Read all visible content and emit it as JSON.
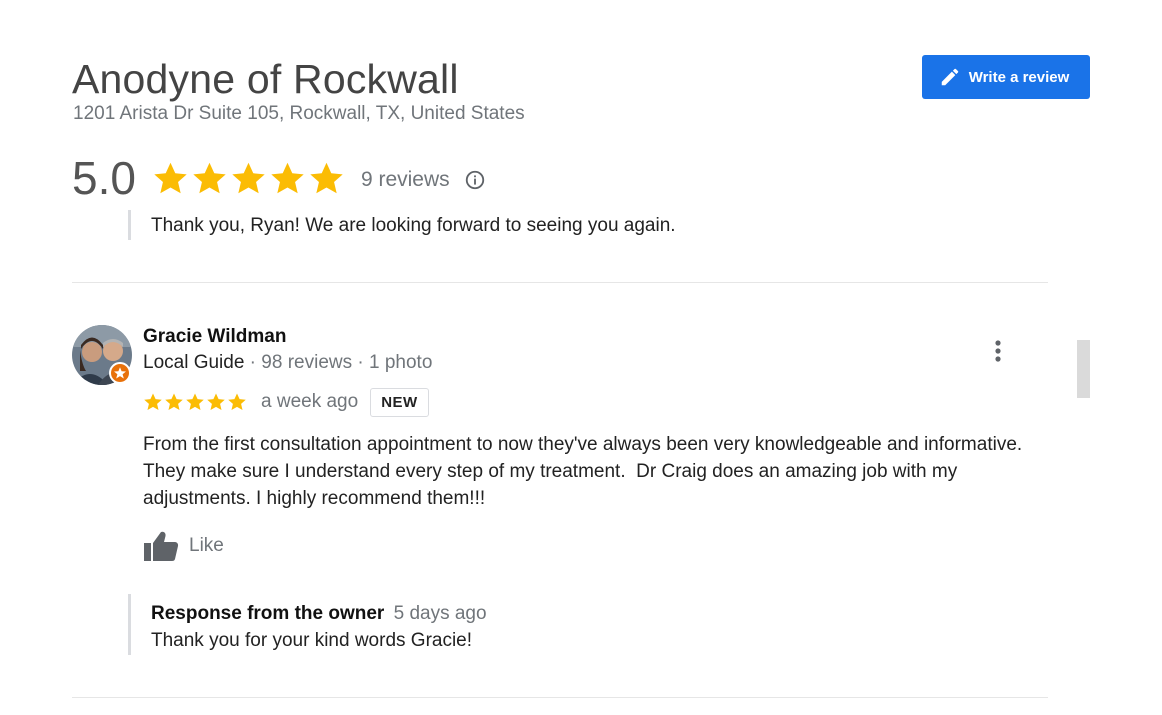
{
  "business": {
    "name": "Anodyne of Rockwall",
    "address": "1201 Arista Dr Suite 105, Rockwall, TX, United States",
    "rating_value": "5.0",
    "rating_stars": 5,
    "review_count_label": "9 reviews"
  },
  "actions": {
    "write_review_label": "Write a review"
  },
  "previous_review": {
    "response_text": "Thank you, Ryan! We are looking forward to seeing you again."
  },
  "review": {
    "author": "Gracie Wildman",
    "author_level": "Local Guide",
    "meta_separator": " · ",
    "author_review_count": "98 reviews",
    "author_photo_count": "1 photo",
    "rating_stars": 5,
    "time": "a week ago",
    "badge": "NEW",
    "text": "From the first consultation appointment to now they've always been very knowledgeable and informative.\nThey make sure I understand every step of my treatment.  Dr Craig does an amazing job with my\nadjustments. I highly recommend them!!!",
    "like_label": "Like",
    "owner_response": {
      "heading": "Response from the owner",
      "time": "5 days ago",
      "text": "Thank you for your kind words Gracie!"
    }
  },
  "icons": {
    "write_review": "pencil-icon",
    "info": "info-icon",
    "more": "more-vert-icon",
    "like": "thumbs-up-icon",
    "local_guide": "local-guide-badge-icon",
    "star": "star-icon"
  },
  "colors": {
    "accent_blue": "#1a73e8",
    "star_gold": "#fbbc04",
    "guide_badge": "#e8710a",
    "secondary_text": "#70757a",
    "divider": "#e6e6e6"
  }
}
